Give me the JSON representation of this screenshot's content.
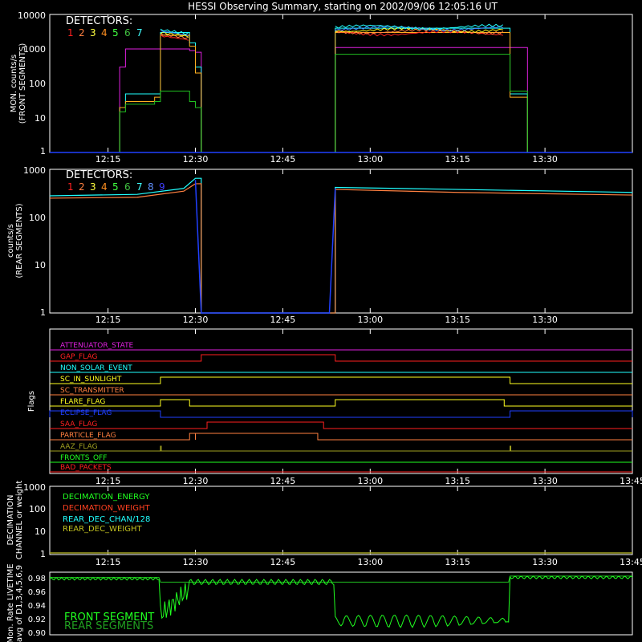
{
  "title": "HESSI Observing Summary, starting on 2002/09/06 12:05:16 UT",
  "x_ticks": [
    "12:15",
    "12:30",
    "12:45",
    "13:00",
    "13:15",
    "13:30"
  ],
  "x_ticks_long": [
    "12:15",
    "12:30",
    "12:45",
    "13:00",
    "13:15",
    "13:30",
    "13:45"
  ],
  "colors": {
    "axis": "#ffffff",
    "bg": "#000000",
    "det": [
      "#ff2020",
      "#ff8040",
      "#ffff40",
      "#ff9020",
      "#40ff40",
      "#40c040",
      "#40ffff",
      "#6090ff",
      "#4040ff"
    ],
    "magenta": "#e020e0",
    "red": "#ff2020",
    "cyan": "#20ffff",
    "orange": "#ff8040",
    "yellow": "#ffff20",
    "blue": "#2040ff",
    "olive": "#a0a020",
    "green": "#20ff20",
    "green2": "#20c020"
  },
  "chart_data": [
    {
      "type": "line",
      "title": "HESSI Observing Summary, starting on 2002/09/06 12:05:16 UT",
      "ylabel": [
        "MON. counts/s",
        "(FRONT SEGMENTS)"
      ],
      "y_scale": "log",
      "ylim": [
        1,
        10000
      ],
      "y_ticks": [
        "1",
        "10",
        "100",
        "1000",
        "10000"
      ],
      "legend_title": "DETECTORS:",
      "legend": [
        "1",
        "2",
        "3",
        "4",
        "5",
        "6",
        "7"
      ],
      "x": [
        "12:05",
        "12:15",
        "12:17",
        "12:18",
        "12:23",
        "12:24",
        "12:29",
        "12:30",
        "12:31",
        "12:53",
        "12:54",
        "13:23",
        "13:24",
        "13:26",
        "13:27",
        "13:45"
      ],
      "series": [
        {
          "values": [
            1,
            1,
            300,
            1000,
            1000,
            1000,
            900,
            800,
            1,
            1,
            1100,
            1100,
            1100,
            1100,
            1,
            1
          ]
        },
        {
          "values": [
            1,
            1,
            20,
            50,
            50,
            3000,
            1500,
            300,
            1,
            1,
            4000,
            4000,
            50,
            50,
            1,
            1
          ]
        },
        {
          "values": [
            1,
            1,
            20,
            30,
            40,
            2500,
            1200,
            200,
            1,
            1,
            3000,
            3000,
            40,
            40,
            1,
            1
          ]
        },
        {
          "values": [
            1,
            1,
            15,
            25,
            30,
            60,
            30,
            20,
            1,
            1,
            700,
            700,
            60,
            60,
            1,
            1
          ]
        }
      ]
    },
    {
      "type": "line",
      "ylabel": [
        "counts/s",
        "(REAR SEGMENTS)"
      ],
      "y_scale": "log",
      "ylim": [
        1,
        1000
      ],
      "y_ticks": [
        "1",
        "10",
        "100",
        "1000"
      ],
      "legend_title": "DETECTORS:",
      "legend": [
        "1",
        "2",
        "3",
        "4",
        "5",
        "6",
        "7",
        "8",
        "9"
      ],
      "x": [
        "12:05",
        "12:20",
        "12:28",
        "12:30",
        "12:31",
        "12:53",
        "12:54",
        "13:15",
        "13:45"
      ],
      "series": [
        {
          "values": [
            280,
            300,
            400,
            650,
            1,
            1,
            420,
            380,
            330
          ]
        },
        {
          "values": [
            250,
            260,
            350,
            500,
            1,
            1,
            380,
            330,
            290
          ]
        }
      ]
    },
    {
      "type": "line",
      "ylabel": [
        "Flags"
      ],
      "labels": [
        "ATTENUATOR_STATE",
        "GAP_FLAG",
        "NON_SOLAR_EVENT",
        "SC_IN_SUNLIGHT",
        "SC_TRANSMITTER",
        "FLARE_FLAG",
        "ECLIPSE_FLAG",
        "SAA_FLAG",
        "PARTICLE_FLAG",
        "AAZ_FLAG",
        "FRONTS_OFF",
        "BAD_PACKETS"
      ]
    },
    {
      "type": "line",
      "ylabel": [
        "DECIMATION",
        "CHANNEL or weight"
      ],
      "y_scale": "log",
      "ylim": [
        1,
        1000
      ],
      "y_ticks": [
        "1",
        "10",
        "100",
        "1000"
      ],
      "legend": [
        "DECIMATION_ENERGY",
        "DECIMATION_WEIGHT",
        "REAR_DEC_CHAN/128",
        "REAR_DEC_WEIGHT"
      ]
    },
    {
      "type": "line",
      "ylabel": [
        "Mon. Rate LIVETIME",
        "avg of D1,3,4,5,6,9"
      ],
      "ylim": [
        0.9,
        0.99
      ],
      "y_ticks": [
        "0.90",
        "0.92",
        "0.94",
        "0.96",
        "0.98"
      ],
      "legend": [
        "FRONT SEGMENT",
        "REAR SEGMENTS"
      ]
    }
  ]
}
